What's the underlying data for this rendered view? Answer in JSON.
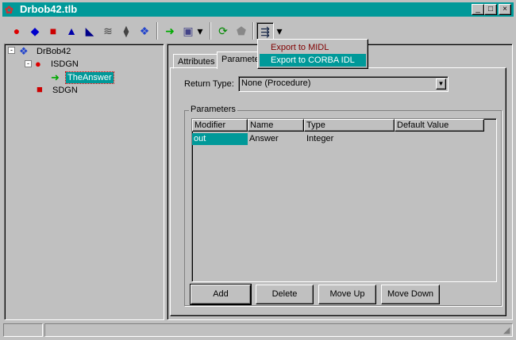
{
  "window": {
    "title": "Drbob42.tlb",
    "minimize": "_",
    "maximize": "□",
    "close": "×"
  },
  "toolbar": {
    "icons": [
      "interface-icon",
      "dispinterface-icon",
      "coclass-icon",
      "enum-icon",
      "alias-icon",
      "record-icon",
      "union-icon",
      "module-icon",
      "method-icon",
      "property-icon",
      "refresh-icon",
      "register-icon",
      "export-icon"
    ],
    "dropdown": "▾"
  },
  "export_menu": {
    "items": [
      "Export to MIDL",
      "Export to CORBA IDL"
    ],
    "highlighted": 1
  },
  "tree": {
    "root": "DrBob42",
    "items": [
      {
        "label": "ISDGN",
        "children": [
          "TheAnswer"
        ]
      },
      {
        "label": "SDGN"
      }
    ]
  },
  "tabs": [
    "Attributes",
    "Parameters"
  ],
  "return_type": {
    "label": "Return Type:",
    "value": "None (Procedure)"
  },
  "parameters": {
    "group_label": "Parameters",
    "columns": [
      "Modifier",
      "Name",
      "Type",
      "Default Value"
    ],
    "rows": [
      [
        "out",
        "Answer",
        "Integer",
        ""
      ]
    ]
  },
  "buttons": {
    "add": "Add",
    "delete": "Delete",
    "move_up": "Move Up",
    "move_down": "Move Down"
  },
  "colors": {
    "title_bar": "#009999",
    "selection": "#009999",
    "menu_text": "#800000"
  }
}
